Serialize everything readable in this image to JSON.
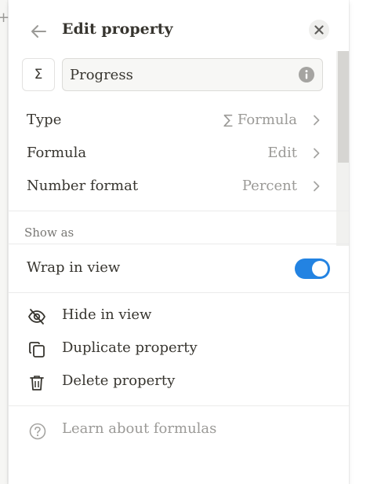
{
  "header": {
    "title": "Edit property",
    "back_icon": "arrow-left-icon",
    "close_icon": "close-icon"
  },
  "name_field": {
    "type_icon": "sigma-icon",
    "type_icon_glyph": "Σ",
    "value": "Progress",
    "info_icon": "info-icon"
  },
  "settings": [
    {
      "label": "Type",
      "value": "Formula",
      "value_icon": "∑"
    },
    {
      "label": "Formula",
      "value": "Edit",
      "value_icon": ""
    },
    {
      "label": "Number format",
      "value": "Percent",
      "value_icon": ""
    }
  ],
  "show_as": {
    "label": "Show as"
  },
  "wrap": {
    "label": "Wrap in view",
    "enabled": true,
    "accent": "#2383e2"
  },
  "actions": [
    {
      "label": "Hide in view",
      "icon": "eye-slash-icon"
    },
    {
      "label": "Duplicate property",
      "icon": "duplicate-icon"
    },
    {
      "label": "Delete property",
      "icon": "trash-icon"
    }
  ],
  "help": {
    "label": "Learn about formulas",
    "icon": "help-circle-icon"
  }
}
